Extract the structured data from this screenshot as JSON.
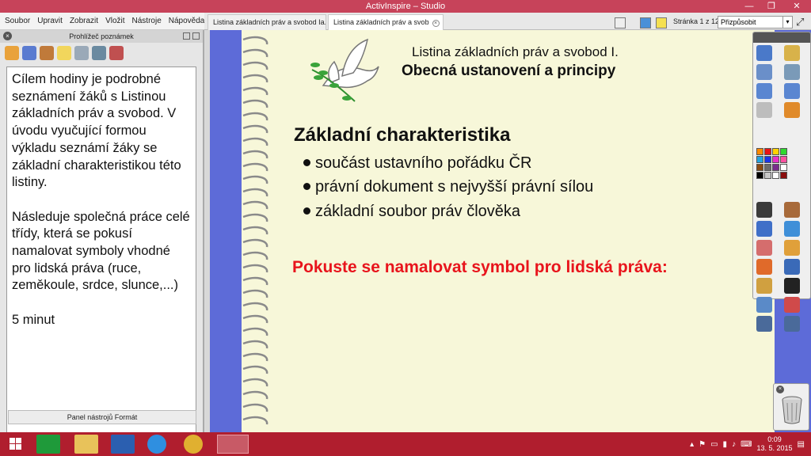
{
  "window": {
    "title": "ActivInspire – Studio"
  },
  "menu": [
    "Soubor",
    "Upravit",
    "Zobrazit",
    "Vložit",
    "Nástroje",
    "Nápověda"
  ],
  "tabs": [
    {
      "label": "Listina základních práv a svobod Ia."
    },
    {
      "label": "Listina základních práv a svob"
    }
  ],
  "page_nav": {
    "counter": "Stránka 1 z 12",
    "zoom": "Přizpůsobit"
  },
  "notes_panel": {
    "title": "Prohlížeč poznámek",
    "text": "Cílem hodiny je podrobné seznámení žáků s Listinou základních práv a svobod. V úvodu vyučující formou výkladu seznámí žáky se základní charakteristikou této listiny.\n\nNásleduje společná práce celé třídy, která se pokusí namalovat symboly vhodné pro lidská práva (ruce, zeměkoule, srdce, slunce,...)\n\n5 minut",
    "footer": "Panel nástrojů Formát"
  },
  "slide": {
    "title_line1": "Listina základních práv a svobod I.",
    "title_line2": "Obecná ustanovení a principy",
    "heading": "Základní charakteristika",
    "bullets": [
      "součást ustavního pořádku ČR",
      "právní dokument s nejvyšší právní sílou",
      "základní soubor práv člověka"
    ],
    "prompt": "Pokuste se namalovat symbol pro lidská práva:"
  },
  "palette": [
    "#ff8a00",
    "#e81416",
    "#ffd200",
    "#2fd92f",
    "#22a4e0",
    "#1c35e6",
    "#e830c8",
    "#ff50a0",
    "#8a4b12",
    "#6b6b6b",
    "#7a2d8c",
    "#ffffff",
    "#000000",
    "#c8c8c8",
    "#ffffff",
    "#8a0e0e"
  ],
  "taskbar": {
    "time": "0:09",
    "date": "13. 5. 2015"
  },
  "colors": {
    "accent": "#c7435a",
    "taskbar": "#b01e2e",
    "page_border": "#5d6bd8",
    "page_bg": "#f7f7d9",
    "prompt": "#e8141c"
  }
}
